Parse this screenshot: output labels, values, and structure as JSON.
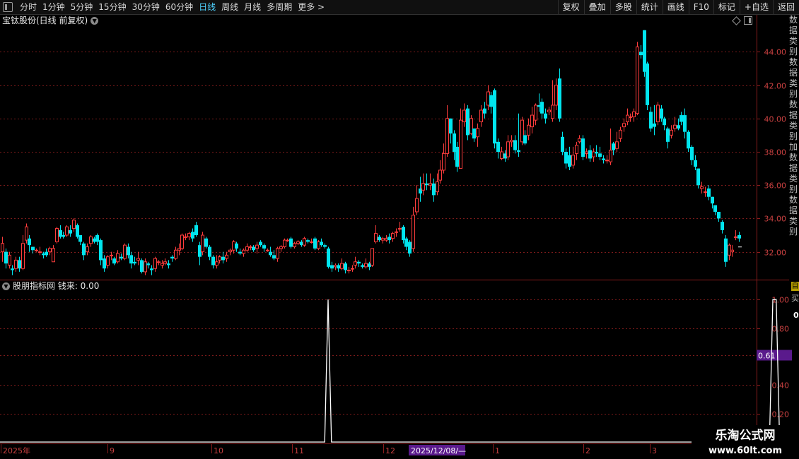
{
  "toolbar": {
    "periods": [
      "分时",
      "1分钟",
      "5分钟",
      "15分钟",
      "30分钟",
      "60分钟",
      "日线",
      "周线",
      "月线",
      "多周期",
      "更多 >"
    ],
    "active_period": "日线",
    "buttons": [
      "复权",
      "叠加",
      "多股",
      "统计",
      "画线",
      "F10",
      "标记",
      "+自选",
      "返回"
    ]
  },
  "main_chart": {
    "title": "宝钛股份(日线 前复权)",
    "y_ticks": [
      "44.00",
      "42.00",
      "40.00",
      "38.00",
      "36.00",
      "34.00",
      "32.00"
    ]
  },
  "right_column_text": "数据类别数据类别数据类别加数据类别数据类别",
  "indicator": {
    "title": "股朋指标网  钱来: 0.00",
    "y_ticks": [
      "1.00",
      "0.80",
      "0.61",
      "0.40",
      "0.20"
    ],
    "current_value_label": "0.61"
  },
  "right_side": {
    "mark": "自",
    "mark2": "买",
    "zero": "0"
  },
  "x_axis": {
    "labels": [
      "2025年",
      "9",
      "10",
      "11",
      "12",
      "1",
      "2",
      "3"
    ],
    "cursor_date": "2025/12/08/—"
  },
  "watermark": {
    "line1": "乐淘公式网",
    "line2": "www.60lt.com"
  },
  "colors": {
    "up": "#ff3c3c",
    "down": "#00e5ee",
    "grid": "#7a1a1a",
    "highlight": "#5a1a8c"
  },
  "chart_data": {
    "type": "candlestick",
    "ylim": [
      30.5,
      45.5
    ],
    "candles": [
      [
        32.0,
        32.5,
        31.4,
        32.9
      ],
      [
        32.0,
        31.3,
        31.0,
        32.2
      ],
      [
        31.2,
        31.8,
        31.0,
        32.0
      ],
      [
        31.0,
        30.9,
        30.6,
        31.2
      ],
      [
        31.0,
        31.5,
        30.8,
        31.7
      ],
      [
        31.5,
        31.0,
        30.8,
        31.7
      ],
      [
        31.0,
        32.5,
        30.9,
        33.0
      ],
      [
        32.7,
        33.5,
        32.5,
        33.7
      ],
      [
        32.8,
        32.4,
        32.0,
        33.0
      ],
      [
        32.3,
        32.1,
        31.9,
        32.3
      ],
      [
        32.1,
        32.1,
        32.0,
        32.2
      ],
      [
        32.0,
        32.0,
        31.8,
        32.3
      ],
      [
        31.9,
        31.8,
        31.6,
        32.0
      ],
      [
        32.0,
        31.8,
        31.7,
        32.2
      ],
      [
        32.0,
        32.2,
        31.8,
        32.3
      ],
      [
        31.4,
        32.2,
        31.4,
        32.4
      ],
      [
        32.6,
        33.4,
        32.5,
        33.5
      ],
      [
        33.3,
        32.9,
        32.8,
        33.6
      ],
      [
        33.0,
        32.9,
        32.8,
        33.2
      ],
      [
        33.0,
        33.5,
        32.9,
        33.6
      ],
      [
        33.3,
        33.1,
        32.9,
        33.6
      ],
      [
        33.4,
        33.9,
        33.2,
        34.0
      ],
      [
        33.6,
        32.9,
        32.8,
        33.7
      ],
      [
        33.0,
        32.6,
        32.4,
        33.0
      ],
      [
        32.5,
        31.8,
        31.5,
        32.6
      ],
      [
        32.0,
        32.3,
        31.8,
        32.5
      ],
      [
        32.5,
        32.9,
        32.3,
        33.0
      ],
      [
        32.8,
        32.6,
        32.5,
        32.9
      ],
      [
        33.0,
        32.6,
        32.4,
        33.1
      ],
      [
        32.7,
        31.5,
        31.2,
        32.8
      ],
      [
        31.6,
        31.0,
        30.8,
        31.8
      ],
      [
        31.2,
        31.7,
        31.0,
        31.8
      ],
      [
        31.8,
        31.8,
        31.5,
        32.0
      ],
      [
        31.6,
        31.3,
        31.2,
        31.7
      ],
      [
        31.4,
        31.9,
        31.3,
        32.1
      ],
      [
        31.7,
        31.6,
        31.5,
        31.9
      ],
      [
        31.6,
        32.4,
        31.5,
        32.5
      ],
      [
        32.3,
        31.8,
        31.6,
        32.5
      ],
      [
        31.8,
        31.3,
        31.0,
        32.0
      ],
      [
        31.4,
        31.3,
        31.2,
        31.7
      ],
      [
        31.5,
        31.6,
        31.2,
        32.0
      ],
      [
        31.5,
        30.8,
        30.7,
        31.6
      ],
      [
        30.8,
        31.4,
        30.6,
        31.6
      ],
      [
        31.3,
        31.2,
        31.0,
        31.4
      ],
      [
        31.0,
        30.9,
        30.6,
        31.2
      ],
      [
        31.0,
        31.6,
        30.8,
        31.7
      ],
      [
        31.4,
        31.4,
        31.2,
        31.5
      ],
      [
        31.2,
        31.3,
        31.0,
        31.5
      ],
      [
        31.3,
        31.4,
        31.2,
        31.6
      ],
      [
        31.3,
        31.2,
        31.0,
        31.5
      ],
      [
        31.7,
        31.6,
        31.4,
        31.8
      ],
      [
        31.6,
        32.1,
        31.5,
        32.3
      ],
      [
        32.1,
        32.2,
        31.8,
        32.5
      ],
      [
        32.2,
        33.0,
        32.1,
        33.1
      ],
      [
        32.9,
        32.9,
        32.7,
        33.1
      ],
      [
        32.9,
        33.1,
        32.7,
        33.2
      ],
      [
        33.2,
        32.8,
        32.6,
        33.4
      ],
      [
        33.6,
        33.0,
        32.9,
        33.8
      ],
      [
        32.4,
        31.7,
        31.2,
        32.6
      ],
      [
        32.0,
        33.0,
        31.8,
        33.2
      ],
      [
        32.8,
        32.3,
        32.2,
        32.9
      ],
      [
        32.3,
        31.7,
        31.5,
        32.4
      ],
      [
        31.7,
        31.2,
        31.0,
        31.8
      ],
      [
        31.2,
        31.4,
        31.0,
        31.8
      ],
      [
        31.5,
        31.7,
        31.3,
        31.8
      ],
      [
        31.7,
        31.5,
        31.3,
        32.0
      ],
      [
        31.6,
        31.8,
        31.4,
        32.0
      ],
      [
        32.0,
        32.1,
        31.8,
        32.2
      ],
      [
        32.1,
        32.6,
        31.9,
        32.7
      ],
      [
        32.5,
        32.2,
        32.0,
        32.6
      ],
      [
        32.0,
        31.9,
        31.8,
        32.2
      ],
      [
        31.9,
        32.1,
        31.7,
        32.2
      ],
      [
        32.1,
        32.3,
        32.0,
        32.5
      ],
      [
        32.3,
        32.3,
        32.1,
        32.4
      ],
      [
        32.3,
        32.1,
        32.0,
        32.4
      ],
      [
        32.2,
        32.4,
        31.9,
        32.6
      ],
      [
        32.6,
        32.4,
        32.3,
        32.7
      ],
      [
        32.4,
        32.2,
        32.0,
        32.5
      ],
      [
        32.1,
        32.1,
        32.0,
        32.2
      ],
      [
        32.0,
        31.8,
        31.7,
        32.3
      ],
      [
        31.8,
        31.6,
        31.5,
        32.1
      ],
      [
        31.6,
        32.2,
        31.4,
        32.3
      ],
      [
        32.2,
        32.3,
        32.0,
        32.4
      ],
      [
        32.3,
        32.7,
        32.2,
        32.8
      ],
      [
        32.7,
        32.7,
        32.6,
        32.8
      ],
      [
        32.8,
        32.3,
        32.2,
        32.9
      ],
      [
        32.3,
        32.5,
        32.2,
        32.6
      ],
      [
        32.5,
        32.6,
        32.4,
        32.7
      ],
      [
        32.6,
        32.4,
        32.3,
        32.7
      ],
      [
        32.4,
        32.8,
        32.3,
        32.9
      ],
      [
        32.7,
        32.6,
        32.5,
        32.8
      ],
      [
        32.6,
        32.6,
        32.5,
        32.8
      ],
      [
        32.8,
        32.2,
        32.1,
        32.9
      ],
      [
        32.2,
        32.6,
        32.1,
        32.7
      ],
      [
        32.6,
        32.4,
        32.3,
        32.8
      ],
      [
        32.4,
        32.3,
        32.2,
        32.5
      ],
      [
        32.2,
        31.1,
        31.0,
        32.3
      ],
      [
        31.2,
        31.0,
        30.8,
        31.4
      ],
      [
        31.1,
        31.2,
        30.9,
        31.3
      ],
      [
        31.2,
        31.0,
        30.8,
        31.3
      ],
      [
        31.0,
        31.3,
        30.9,
        31.6
      ],
      [
        31.3,
        30.9,
        30.7,
        31.4
      ],
      [
        30.9,
        30.9,
        30.7,
        31.1
      ],
      [
        31.0,
        31.0,
        30.8,
        31.2
      ],
      [
        31.2,
        31.4,
        31.0,
        31.7
      ],
      [
        31.4,
        31.3,
        31.1,
        31.5
      ],
      [
        31.2,
        31.1,
        31.0,
        31.3
      ],
      [
        31.1,
        31.3,
        31.0,
        31.6
      ],
      [
        31.3,
        31.1,
        30.9,
        31.4
      ],
      [
        31.2,
        32.2,
        31.1,
        32.2
      ],
      [
        32.6,
        33.1,
        32.5,
        33.6
      ],
      [
        32.9,
        32.7,
        32.6,
        33.0
      ],
      [
        32.7,
        32.8,
        32.5,
        32.9
      ],
      [
        32.7,
        32.8,
        32.6,
        33.0
      ],
      [
        32.9,
        32.7,
        32.5,
        33.1
      ],
      [
        32.8,
        33.1,
        32.6,
        33.2
      ],
      [
        33.2,
        33.2,
        32.9,
        33.4
      ],
      [
        33.4,
        33.4,
        33.2,
        33.8
      ],
      [
        33.5,
        32.7,
        32.5,
        33.6
      ],
      [
        32.8,
        32.3,
        32.1,
        32.9
      ],
      [
        32.6,
        31.9,
        31.7,
        32.7
      ],
      [
        32.2,
        34.2,
        32.0,
        34.7
      ],
      [
        34.4,
        35.2,
        34.2,
        36.0
      ],
      [
        35.8,
        35.5,
        35.0,
        36.5
      ],
      [
        35.7,
        36.1,
        35.4,
        36.7
      ],
      [
        36.1,
        36.0,
        35.7,
        36.7
      ],
      [
        36.0,
        36.1,
        35.7,
        36.7
      ],
      [
        36.1,
        35.4,
        35.0,
        36.4
      ],
      [
        35.6,
        36.2,
        35.4,
        36.7
      ],
      [
        36.3,
        36.9,
        36.1,
        37.5
      ],
      [
        36.9,
        37.9,
        36.7,
        38.5
      ],
      [
        37.9,
        40.0,
        37.7,
        40.8
      ],
      [
        40.0,
        39.1,
        38.5,
        40.0
      ],
      [
        39.1,
        38.0,
        37.5,
        39.3
      ],
      [
        38.3,
        37.1,
        36.8,
        38.6
      ],
      [
        37.0,
        39.9,
        37.0,
        40.6
      ],
      [
        39.8,
        40.5,
        39.5,
        40.9
      ],
      [
        40.6,
        39.0,
        38.7,
        40.8
      ],
      [
        39.1,
        40.0,
        39.0,
        40.2
      ],
      [
        39.4,
        38.8,
        38.6,
        39.4
      ],
      [
        38.9,
        39.4,
        38.3,
        39.7
      ],
      [
        39.8,
        40.5,
        39.5,
        40.8
      ],
      [
        40.6,
        40.3,
        40.0,
        41.0
      ],
      [
        40.8,
        41.6,
        40.5,
        42.0
      ],
      [
        41.4,
        40.7,
        40.3,
        41.6
      ],
      [
        41.7,
        38.5,
        38.2,
        41.8
      ],
      [
        38.6,
        38.0,
        37.6,
        38.8
      ],
      [
        37.6,
        38.0,
        37.5,
        38.3
      ],
      [
        37.9,
        37.6,
        37.4,
        38.1
      ],
      [
        37.7,
        38.6,
        37.5,
        39.0
      ],
      [
        38.6,
        38.7,
        38.3,
        39.0
      ],
      [
        38.7,
        38.1,
        37.9,
        39.0
      ],
      [
        38.1,
        38.0,
        37.7,
        40.3
      ],
      [
        38.6,
        39.9,
        38.4,
        40.1
      ],
      [
        39.0,
        38.5,
        38.4,
        39.3
      ],
      [
        39.0,
        39.6,
        38.7,
        40.0
      ],
      [
        39.5,
        40.2,
        39.1,
        40.7
      ],
      [
        39.9,
        40.8,
        39.6,
        40.9
      ],
      [
        40.8,
        40.7,
        40.4,
        41.5
      ],
      [
        41.0,
        40.3,
        40.0,
        41.2
      ],
      [
        40.3,
        40.0,
        39.7,
        40.6
      ],
      [
        40.4,
        40.5,
        40.2,
        40.7
      ],
      [
        40.0,
        40.8,
        39.8,
        42.3
      ],
      [
        40.8,
        42.0,
        40.5,
        42.4
      ],
      [
        42.4,
        40.0,
        39.8,
        43.0
      ],
      [
        38.9,
        38.0,
        37.8,
        39.2
      ],
      [
        38.0,
        37.3,
        37.0,
        38.2
      ],
      [
        37.8,
        37.1,
        36.9,
        38.3
      ],
      [
        37.2,
        37.8,
        37.0,
        38.3
      ],
      [
        37.9,
        38.4,
        37.5,
        38.6
      ],
      [
        38.6,
        38.8,
        38.5,
        39.0
      ],
      [
        38.8,
        37.7,
        37.5,
        39.0
      ],
      [
        37.9,
        38.0,
        37.6,
        38.2
      ],
      [
        38.1,
        37.6,
        37.4,
        38.4
      ],
      [
        37.7,
        38.0,
        37.4,
        38.2
      ],
      [
        38.0,
        37.9,
        37.7,
        38.4
      ],
      [
        37.9,
        37.7,
        37.5,
        38.3
      ],
      [
        37.6,
        37.5,
        37.3,
        37.8
      ],
      [
        37.5,
        37.5,
        37.3,
        37.8
      ],
      [
        37.4,
        38.1,
        37.2,
        39.4
      ],
      [
        38.5,
        38.1,
        37.8,
        38.6
      ],
      [
        38.2,
        38.6,
        38.0,
        39.2
      ],
      [
        38.8,
        39.3,
        38.6,
        39.5
      ],
      [
        39.5,
        39.7,
        39.2,
        40.0
      ],
      [
        39.8,
        40.2,
        39.6,
        40.6
      ],
      [
        40.1,
        40.1,
        39.8,
        40.3
      ],
      [
        40.1,
        40.4,
        39.8,
        40.6
      ],
      [
        40.3,
        44.3,
        40.2,
        44.6
      ],
      [
        44.0,
        43.8,
        43.6,
        44.4
      ],
      [
        45.3,
        42.8,
        42.5,
        45.3
      ],
      [
        43.3,
        40.8,
        40.5,
        43.4
      ],
      [
        40.4,
        39.4,
        39.2,
        40.7
      ],
      [
        39.7,
        39.5,
        39.0,
        40.8
      ],
      [
        39.8,
        40.8,
        39.6,
        41.0
      ],
      [
        40.6,
        40.0,
        39.8,
        40.8
      ],
      [
        40.0,
        39.6,
        39.3,
        40.1
      ],
      [
        39.4,
        38.6,
        38.2,
        39.5
      ],
      [
        39.0,
        39.3,
        38.8,
        39.6
      ],
      [
        39.4,
        39.6,
        39.2,
        40.1
      ],
      [
        39.6,
        39.4,
        39.3,
        40.0
      ],
      [
        40.2,
        39.8,
        39.6,
        40.4
      ],
      [
        40.2,
        39.2,
        38.8,
        40.6
      ],
      [
        39.2,
        38.2,
        38.0,
        39.3
      ],
      [
        38.3,
        37.5,
        37.2,
        38.4
      ],
      [
        37.5,
        37.1,
        36.9,
        37.8
      ],
      [
        37.0,
        36.0,
        35.8,
        37.0
      ],
      [
        35.8,
        35.9,
        35.5,
        36.2
      ],
      [
        35.6,
        35.6,
        35.3,
        35.9
      ],
      [
        35.8,
        35.3,
        35.1,
        36.0
      ],
      [
        35.3,
        34.9,
        34.6,
        35.3
      ],
      [
        34.8,
        34.4,
        34.2,
        34.8
      ],
      [
        34.4,
        34.0,
        33.8,
        34.4
      ],
      [
        33.8,
        33.3,
        33.1,
        33.9
      ],
      [
        32.8,
        31.4,
        31.1,
        33.0
      ],
      [
        31.8,
        32.4,
        31.5,
        32.5
      ],
      [
        32.0,
        32.1,
        31.7,
        32.4
      ],
      [
        32.9,
        32.9,
        32.7,
        33.3
      ],
      [
        33.0,
        32.8,
        32.6,
        33.2
      ]
    ],
    "indicator_series": {
      "name": "钱来",
      "ylim": [
        0,
        1.1
      ],
      "pulses": [
        {
          "start_index": 95,
          "peak_from": 96,
          "peak_to": 96,
          "end_index": 97
        },
        {
          "start_index": 226,
          "peak_from": 227,
          "peak_to": 228,
          "end_index": 229
        }
      ]
    }
  }
}
